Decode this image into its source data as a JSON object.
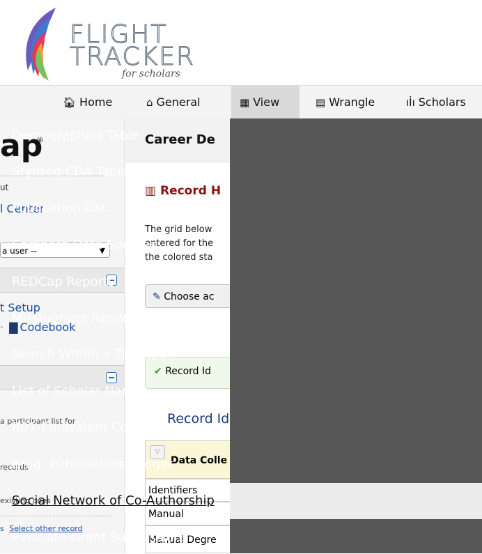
{
  "logo": {
    "line1": "FLIGHT",
    "line2": "TRACKER",
    "line3": "for scholars"
  },
  "nav": {
    "home": "Home",
    "general": "General",
    "view": "View",
    "wrangle": "Wrangle",
    "scholars": "Scholars"
  },
  "sidebar": {
    "brand_partial": "ap",
    "link_out": "ut",
    "control_center": "l Center",
    "user_select": "a user --",
    "project_setup": "t Setup",
    "codebook": "Codebook",
    "participant_list": "a participant list for",
    "records": "records",
    "existing": "existing ones",
    "s_prefix": "s",
    "select_other": "Select other record"
  },
  "main": {
    "header": "Career De",
    "record_heading": "Record H",
    "para1": "The grid below",
    "para2": "entered for the",
    "para3": "the colored sta",
    "choose_button": "Choose ac",
    "record_id_box": "Record Id",
    "record_label": "Record Id",
    "table_header": "Data Colle",
    "rows": [
      "Identifiers",
      "Manual",
      "Manual Degre"
    ]
  },
  "dropdown": {
    "items": [
      "Demographics Table",
      "Stylized CDA Table",
      "Publication List",
      "Compare Data Sources",
      "REDCap Reports",
      "Missingness Report",
      "Search Within a Timespan",
      "List of Scholar Names",
      "R01-Equivalent Conversions",
      "Brag: Publications Widget",
      "Social Network of Co-Authorship",
      "Evaluate Grant Submissions"
    ],
    "highlighted_index": 10
  },
  "colors": {
    "dropdown_bg": "#585858",
    "highlight_bg": "#ececec",
    "link_blue": "#1a4fa0",
    "heading_red": "#8b1111"
  }
}
